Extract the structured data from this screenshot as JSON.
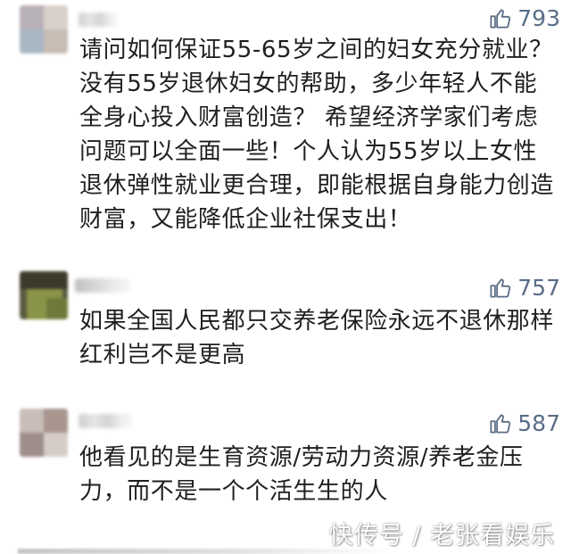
{
  "comments": [
    {
      "likes": "793",
      "text": "请问如何保证55-65岁之间的妇女充分就业？没有55岁退休妇女的帮助，多少年轻人不能全身心投入财富创造？ 希望经济学家们考虑问题可以全面一些！个人认为55岁以上女性退休弹性就业更合理，即能根据自身能力创造财富，又能降低企业社保支出！"
    },
    {
      "likes": "757",
      "text": "如果全国人民都只交养老保险永远不退休那样红利岂不是更高"
    },
    {
      "likes": "587",
      "text": "他看见的是生育资源/劳动力资源/养老金压力，而不是一个个活生生的人"
    }
  ],
  "watermark": "快传号 / 老张看娱乐",
  "like_icon": "thumbs-up-icon",
  "colors": {
    "like": "#5a6d86",
    "text": "#1f1f1f",
    "background": "#ffffff"
  }
}
